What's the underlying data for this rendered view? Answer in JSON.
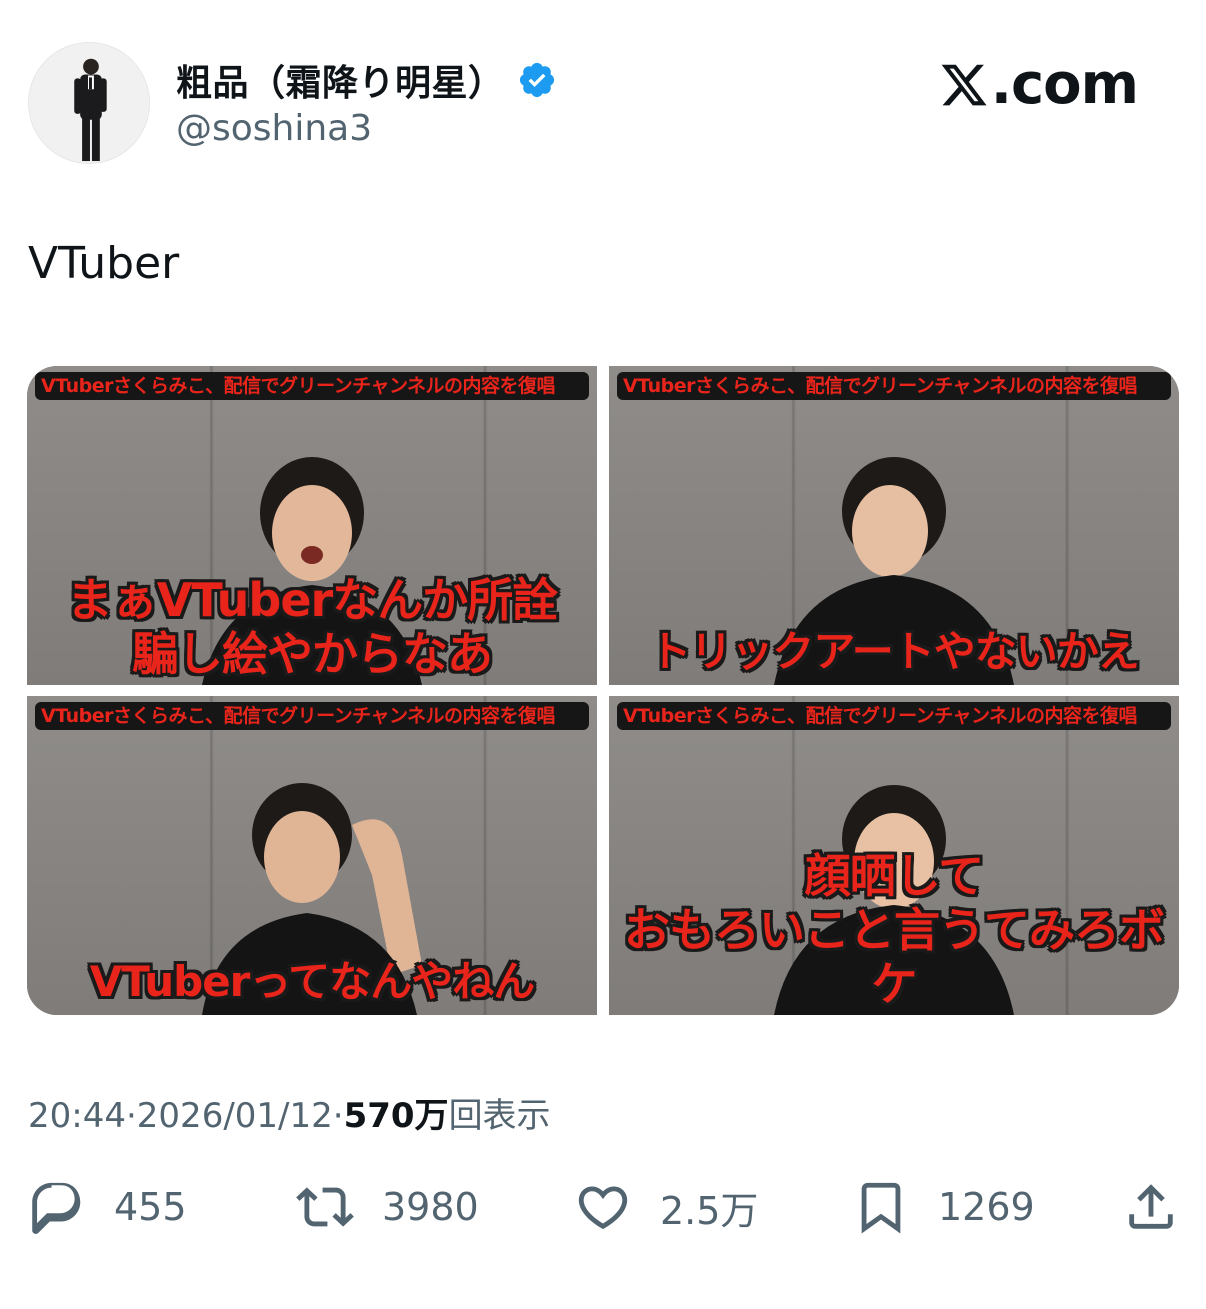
{
  "author": {
    "display_name": "粗品（霜降り明星）",
    "handle": "@soshina3",
    "verified": true
  },
  "brand": {
    "text": "X.com"
  },
  "tweet": {
    "text": "VTuber"
  },
  "media": [
    {
      "top_caption": "VTuberさくらみこ、配信でグリーンチャンネルの内容を復唱",
      "overlay_lines": [
        "まぁVTuberなんか所詮",
        "騙し絵やからなあ"
      ]
    },
    {
      "top_caption": "VTuberさくらみこ、配信でグリーンチャンネルの内容を復唱",
      "overlay_lines": [
        "トリックアートやないかえ"
      ]
    },
    {
      "top_caption": "VTuberさくらみこ、配信でグリーンチャンネルの内容を復唱",
      "overlay_lines": [
        "VTuberってなんやねん"
      ]
    },
    {
      "top_caption": "VTuberさくらみこ、配信でグリーンチャンネルの内容を復唱",
      "overlay_lines": [
        "顔晒して",
        "おもろいこと言うてみろボケ"
      ]
    }
  ],
  "meta": {
    "time": "20:44",
    "separator": " · ",
    "date": "2026/01/12",
    "views_number": "570万",
    "views_label": "回表示"
  },
  "actions": {
    "reply_count": "455",
    "retweet_count": "3980",
    "like_count": "2.5万",
    "bookmark_count": "1269"
  },
  "colors": {
    "verified_blue": "#1d9bf0",
    "caption_red": "#e8241b",
    "text_secondary": "#536471"
  },
  "icons": {
    "reply": "reply-icon",
    "retweet": "retweet-icon",
    "like": "heart-icon",
    "bookmark": "bookmark-icon",
    "share": "share-icon"
  }
}
